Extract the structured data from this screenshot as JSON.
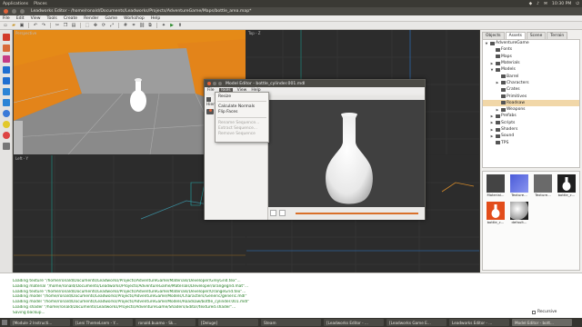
{
  "system_bar": {
    "applications": "Applications",
    "places": "Places",
    "clock": "10:30 PM"
  },
  "window": {
    "title": "Leadworks Editor - /home/ronald/Documents/Leadworks/Projects/AdventureGame/Maps/bottle_area.map*"
  },
  "menu": [
    "File",
    "Edit",
    "View",
    "Tools",
    "Create",
    "Render",
    "Game",
    "Workshop",
    "Help"
  ],
  "viewports": {
    "perspective_label": "Perspective",
    "top_label": "Top - Z",
    "left_label": "Left - Y"
  },
  "right_panel": {
    "tabs": [
      "Objects",
      "Assets",
      "Scene",
      "Terrain"
    ],
    "active_tab": "Assets",
    "tree": [
      {
        "label": "AdventureGame",
        "depth": 0,
        "arrow": "down"
      },
      {
        "label": "Fonts",
        "depth": 1,
        "arrow": ""
      },
      {
        "label": "Maps",
        "depth": 1,
        "arrow": ""
      },
      {
        "label": "Materials",
        "depth": 1,
        "arrow": "right"
      },
      {
        "label": "Models",
        "depth": 1,
        "arrow": "down"
      },
      {
        "label": "Barrel",
        "depth": 2,
        "arrow": ""
      },
      {
        "label": "Characters",
        "depth": 2,
        "arrow": "right"
      },
      {
        "label": "Crates",
        "depth": 2,
        "arrow": ""
      },
      {
        "label": "Primitives",
        "depth": 2,
        "arrow": ""
      },
      {
        "label": "Roadsaw",
        "depth": 2,
        "arrow": "",
        "selected": true
      },
      {
        "label": "Weapons",
        "depth": 2,
        "arrow": "right"
      },
      {
        "label": "Prefabs",
        "depth": 1,
        "arrow": "right"
      },
      {
        "label": "Scripts",
        "depth": 1,
        "arrow": "right"
      },
      {
        "label": "Shaders",
        "depth": 1,
        "arrow": "right"
      },
      {
        "label": "Sound",
        "depth": 1,
        "arrow": "right"
      },
      {
        "label": "TPS",
        "depth": 1,
        "arrow": ""
      }
    ],
    "assets": [
      {
        "name": "Material...",
        "thumb": "material"
      },
      {
        "name": "Texture...",
        "thumb": "texture"
      },
      {
        "name": "Texture...",
        "thumb": "texture2"
      },
      {
        "name": "bottle_c...",
        "thumb": "bottle"
      },
      {
        "name": "bottle_c...",
        "thumb": "bottle-selected"
      },
      {
        "name": "default...",
        "thumb": "sphere"
      }
    ]
  },
  "model_editor": {
    "title": "Model Editor - bottle_cylinder.001.mdl",
    "menu": [
      "File",
      "Tools",
      "View",
      "Help"
    ],
    "open_menu": "Tools",
    "left_header": "Hierar",
    "tools_menu": [
      {
        "label": "Resize",
        "enabled": true
      },
      {
        "label": "Calculate Normals",
        "enabled": true
      },
      {
        "label": "Flip Faces",
        "enabled": true
      },
      {
        "label": "Rename Sequence...",
        "enabled": false
      },
      {
        "label": "Extract Sequence...",
        "enabled": false
      },
      {
        "label": "Remove Sequence",
        "enabled": false
      }
    ]
  },
  "console": [
    "Loading texture \"/home/ronald/Documents/Leadworks/Projects/AdventureGame/Materials/Developer/GreyGrid.tex\"...",
    "Loading material \"/home/ronald/Documents/Leadworks/Projects/AdventureGame/Materials/Developer/orangegrid.mat\"...",
    "Loading texture \"/home/ronald/Documents/Leadworks/Projects/AdventureGame/Materials/Developer/OrangeGrid.tex\"...",
    "Loading model \"/home/ronald/Documents/Leadworks/Projects/AdventureGame/Models/Characters/Generic/generic.mdl\"",
    "Loading model \"/home/ronald/Documents/Leadworks/Projects/AdventureGame/Models/Roadsaw/bottle_cylinder.001.mdl\"",
    "Loading shader \"/home/ronald/Documents/Leadworks/Projects/AdventureGame/Shaders/Editor/textured.shader\"...",
    "Saving backup..."
  ],
  "status": {
    "recursive_label": "Recursive"
  },
  "taskbar": [
    {
      "label": "[Module 2 Instructi..."
    },
    {
      "label": "[Leni ThemeLsem - Y..."
    },
    {
      "label": "ronald.buamo - Sk..."
    },
    {
      "label": "[Deluge]"
    },
    {
      "label": "Steam"
    },
    {
      "label": "[Leadworks Editor - ..."
    },
    {
      "label": "[Leadworks Game E..."
    },
    {
      "label": "Leadworks Editor - ..."
    },
    {
      "label": "Model Editor - bott..."
    }
  ]
}
